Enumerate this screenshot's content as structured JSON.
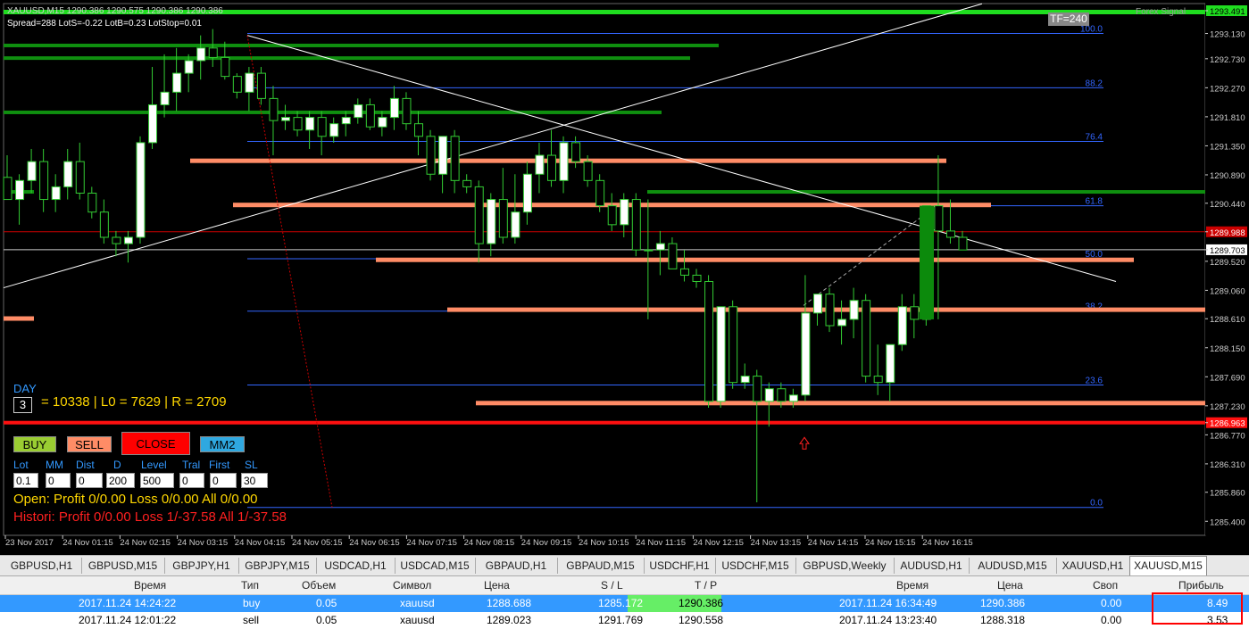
{
  "header": {
    "symbol_line": "XAUUSD,M15  1290.386 1290.575 1290.386 1290.386",
    "spread_line": "Spread=288  LotS=-0.22  LotB=0.23  LotStop=0.01",
    "tf_badge": "TF=240",
    "brand": "Forex Signal"
  },
  "chart_data": {
    "type": "candlestick",
    "ylim": [
      1285.22,
      1293.491
    ],
    "price_ticks": [
      "1293.491",
      "1293.130",
      "1292.730",
      "1292.270",
      "1291.810",
      "1291.350",
      "1290.890",
      "1290.440",
      "1289.988",
      "1289.703",
      "1289.520",
      "1289.060",
      "1288.610",
      "1288.150",
      "1287.690",
      "1287.230",
      "1286.963",
      "1286.770",
      "1286.310",
      "1285.860",
      "1285.400"
    ],
    "highlight_prices": {
      "top": "1293.491",
      "red": "1289.988",
      "current": "1289.703",
      "stop": "1286.963"
    },
    "time_labels": [
      "23 Nov 2017",
      "24 Nov 01:15",
      "24 Nov 02:15",
      "24 Nov 03:15",
      "24 Nov 04:15",
      "24 Nov 05:15",
      "24 Nov 06:15",
      "24 Nov 07:15",
      "24 Nov 08:15",
      "24 Nov 09:15",
      "24 Nov 10:15",
      "24 Nov 11:15",
      "24 Nov 12:15",
      "24 Nov 13:15",
      "24 Nov 14:15",
      "24 Nov 15:15",
      "24 Nov 16:15"
    ],
    "fib_levels": [
      {
        "label": "100.0",
        "price": 1293.13
      },
      {
        "label": "88.2",
        "price": 1292.27
      },
      {
        "label": "76.4",
        "price": 1291.42
      },
      {
        "label": "61.8",
        "price": 1290.4
      },
      {
        "label": "50.0",
        "price": 1289.56
      },
      {
        "label": "38.2",
        "price": 1288.73
      },
      {
        "label": "23.6",
        "price": 1287.56
      },
      {
        "label": "0.0",
        "price": 1285.62
      }
    ],
    "candles": [
      [
        1290.85,
        1291.2,
        1290.5,
        1290.5
      ],
      [
        1290.5,
        1290.9,
        1290.1,
        1290.8
      ],
      [
        1290.8,
        1291.3,
        1290.6,
        1291.1
      ],
      [
        1291.1,
        1291.3,
        1290.3,
        1290.5
      ],
      [
        1290.5,
        1290.9,
        1290.3,
        1290.7
      ],
      [
        1290.7,
        1291.3,
        1290.5,
        1291.1
      ],
      [
        1291.1,
        1291.4,
        1290.5,
        1290.6
      ],
      [
        1290.6,
        1290.7,
        1290.2,
        1290.3
      ],
      [
        1290.3,
        1290.5,
        1289.8,
        1289.9
      ],
      [
        1289.9,
        1290.0,
        1289.6,
        1289.8
      ],
      [
        1289.8,
        1290.0,
        1289.5,
        1289.9
      ],
      [
        1289.9,
        1291.5,
        1289.8,
        1291.4
      ],
      [
        1291.4,
        1292.6,
        1291.3,
        1292.0
      ],
      [
        1292.0,
        1292.8,
        1291.8,
        1292.2
      ],
      [
        1292.2,
        1292.9,
        1291.9,
        1292.5
      ],
      [
        1292.5,
        1292.8,
        1292.2,
        1292.7
      ],
      [
        1292.7,
        1293.1,
        1292.4,
        1292.9
      ],
      [
        1292.9,
        1293.2,
        1292.6,
        1292.75
      ],
      [
        1292.75,
        1293.0,
        1292.4,
        1292.45
      ],
      [
        1292.45,
        1292.5,
        1292.1,
        1292.2
      ],
      [
        1292.2,
        1292.6,
        1291.9,
        1292.5
      ],
      [
        1292.5,
        1292.6,
        1292.0,
        1292.1
      ],
      [
        1292.1,
        1292.3,
        1291.2,
        1291.75
      ],
      [
        1291.75,
        1292.0,
        1291.6,
        1291.8
      ],
      [
        1291.8,
        1291.9,
        1291.5,
        1291.6
      ],
      [
        1291.6,
        1291.9,
        1291.3,
        1291.8
      ],
      [
        1291.8,
        1291.9,
        1291.2,
        1291.5
      ],
      [
        1291.5,
        1291.8,
        1291.4,
        1291.7
      ],
      [
        1291.7,
        1291.9,
        1291.5,
        1291.8
      ],
      [
        1291.8,
        1292.1,
        1291.7,
        1292.0
      ],
      [
        1292.0,
        1292.1,
        1291.6,
        1291.65
      ],
      [
        1291.65,
        1291.9,
        1291.5,
        1291.8
      ],
      [
        1291.8,
        1292.3,
        1291.6,
        1292.1
      ],
      [
        1292.1,
        1292.2,
        1291.6,
        1291.7
      ],
      [
        1291.7,
        1291.9,
        1291.2,
        1291.5
      ],
      [
        1291.5,
        1291.6,
        1290.8,
        1290.9
      ],
      [
        1290.9,
        1291.5,
        1290.6,
        1291.5
      ],
      [
        1291.5,
        1291.6,
        1290.6,
        1290.8
      ],
      [
        1290.8,
        1290.9,
        1290.6,
        1290.7
      ],
      [
        1290.7,
        1290.8,
        1289.5,
        1289.8
      ],
      [
        1289.8,
        1290.6,
        1289.6,
        1290.5
      ],
      [
        1290.5,
        1291.0,
        1289.8,
        1289.9
      ],
      [
        1289.9,
        1290.9,
        1289.8,
        1290.3
      ],
      [
        1290.3,
        1291.1,
        1290.1,
        1290.9
      ],
      [
        1290.9,
        1291.4,
        1290.6,
        1291.2
      ],
      [
        1291.2,
        1291.6,
        1290.7,
        1290.8
      ],
      [
        1290.8,
        1291.5,
        1290.6,
        1291.4
      ],
      [
        1291.4,
        1291.5,
        1291.0,
        1291.1
      ],
      [
        1291.1,
        1291.2,
        1290.7,
        1290.8
      ],
      [
        1290.8,
        1290.9,
        1290.3,
        1290.4
      ],
      [
        1290.4,
        1290.6,
        1290.0,
        1290.1
      ],
      [
        1290.1,
        1290.6,
        1289.9,
        1290.5
      ],
      [
        1290.5,
        1290.6,
        1289.6,
        1289.7
      ],
      [
        1289.7,
        1290.5,
        1288.6,
        1289.7
      ],
      [
        1289.7,
        1290.0,
        1289.3,
        1289.8
      ],
      [
        1289.8,
        1289.9,
        1289.4,
        1289.4
      ],
      [
        1289.4,
        1289.7,
        1289.2,
        1289.3
      ],
      [
        1289.3,
        1289.4,
        1289.1,
        1289.2
      ],
      [
        1289.2,
        1289.3,
        1287.2,
        1287.3
      ],
      [
        1287.3,
        1288.8,
        1287.2,
        1288.8
      ],
      [
        1288.8,
        1288.9,
        1287.5,
        1287.6
      ],
      [
        1287.6,
        1287.9,
        1287.5,
        1287.7
      ],
      [
        1287.7,
        1287.8,
        1285.7,
        1287.3
      ],
      [
        1287.3,
        1287.6,
        1286.9,
        1287.5
      ],
      [
        1287.5,
        1287.6,
        1287.2,
        1287.3
      ],
      [
        1287.3,
        1287.5,
        1287.2,
        1287.4
      ],
      [
        1287.4,
        1289.3,
        1287.3,
        1288.7
      ],
      [
        1288.7,
        1289.0,
        1288.5,
        1289.0
      ],
      [
        1289.0,
        1289.1,
        1288.4,
        1288.5
      ],
      [
        1288.5,
        1288.9,
        1288.2,
        1288.6
      ],
      [
        1288.6,
        1289.1,
        1288.3,
        1288.9
      ],
      [
        1288.9,
        1289.0,
        1287.6,
        1287.7
      ],
      [
        1287.7,
        1288.2,
        1287.4,
        1287.6
      ],
      [
        1287.6,
        1288.1,
        1287.3,
        1288.2
      ],
      [
        1288.2,
        1289.0,
        1288.1,
        1288.8
      ],
      [
        1288.8,
        1289.0,
        1288.3,
        1288.6
      ],
      [
        1288.6,
        1290.4,
        1288.5,
        1290.4
      ],
      [
        1290.4,
        1291.2,
        1288.6,
        1290.0
      ],
      [
        1290.0,
        1290.5,
        1289.8,
        1289.9
      ],
      [
        1289.9,
        1290.0,
        1289.7,
        1289.7
      ]
    ]
  },
  "stats": {
    "day_label": "DAY",
    "day_value": "3",
    "summary": "= 10338 | L0 = 7629 | R = 2709"
  },
  "controls": {
    "buy": "BUY",
    "sell": "SELL",
    "close": "CLOSE",
    "mm2": "MM2",
    "labels": [
      "Lot",
      "MM",
      "Dist",
      "D",
      "Level",
      "Tral",
      "First",
      "SL"
    ],
    "values": [
      "0.1",
      "0",
      "0",
      "200",
      "500",
      "0",
      "0",
      "30"
    ],
    "open_line": "Open:  Profit 0/0.00  Loss 0/0.00  All 0/0.00",
    "history_line": "Histori: Profit 0/0.00  Loss 1/-37.58  All 1/-37.58"
  },
  "tabs": [
    "GBPUSD,H1",
    "GBPUSD,M15",
    "GBPJPY,H1",
    "GBPJPY,M15",
    "USDCAD,H1",
    "USDCAD,M15",
    "GBPAUD,H1",
    "GBPAUD,M15",
    "USDCHF,H1",
    "USDCHF,M15",
    "GBPUSD,Weekly",
    "AUDUSD,H1",
    "AUDUSD,M15",
    "XAUUSD,H1",
    "XAUUSD,M15"
  ],
  "terminal": {
    "headers": [
      "Время",
      "Тип",
      "Объем",
      "Символ",
      "Цена",
      "S / L",
      "T / P",
      "Время",
      "Цена",
      "Своп",
      "Прибыль"
    ],
    "rows": [
      [
        "2017.11.24 14:24:22",
        "buy",
        "0.05",
        "xauusd",
        "1288.688",
        "1285.172",
        "1290.386",
        "2017.11.24 16:34:49",
        "1290.386",
        "0.00",
        "8.49"
      ],
      [
        "2017.11.24 12:01:22",
        "sell",
        "0.05",
        "xauusd",
        "1289.023",
        "1291.769",
        "1290.558",
        "2017.11.24 13:23:40",
        "1288.318",
        "0.00",
        "3.53"
      ]
    ]
  },
  "colors": {
    "bull": "#ffffff",
    "bear": "#000000",
    "wick": "#33cc33",
    "orange": "#ff8c66",
    "green_band": "#0f8f0f",
    "fib": "#3366ff",
    "accent_red": "#ff1a1a"
  }
}
